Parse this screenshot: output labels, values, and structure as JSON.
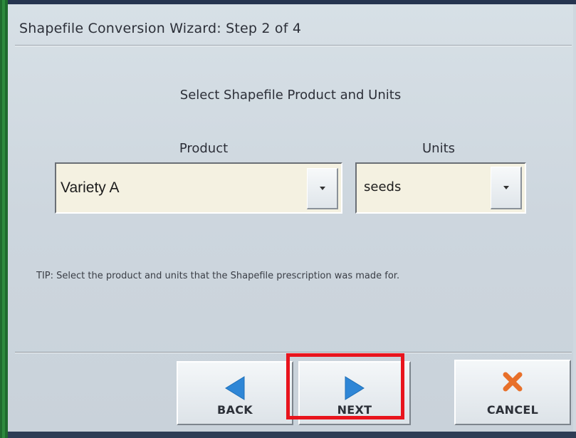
{
  "window": {
    "title": "Shapefile Conversion Wizard:  Step 2 of 4"
  },
  "main": {
    "heading": "Select Shapefile Product and Units",
    "product": {
      "label": "Product",
      "value": "Variety A"
    },
    "units": {
      "label": "Units",
      "value": "seeds"
    },
    "tip": "TIP:  Select the product and units that the Shapefile prescription was made for."
  },
  "footer": {
    "back_label": "BACK",
    "next_label": "NEXT",
    "cancel_label": "CANCEL"
  },
  "colors": {
    "arrow_blue": "#2e86d6",
    "cancel_x": "#e8702a",
    "highlight_red": "#e8141d",
    "combo_bg": "#f4f1e1"
  },
  "icons": {
    "back": "left-arrow-icon",
    "next": "right-arrow-icon",
    "cancel": "x-icon",
    "dropdown": "chevron-down-icon"
  }
}
